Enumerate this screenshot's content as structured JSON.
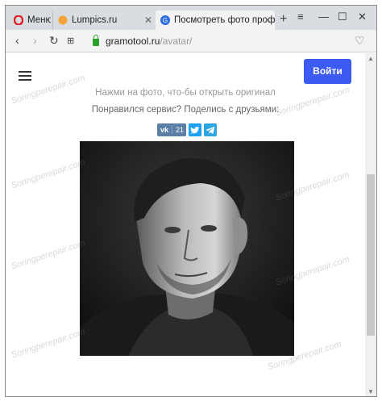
{
  "tabs": [
    {
      "label": "Меню"
    },
    {
      "label": "Lumpics.ru"
    },
    {
      "label": "Посмотреть фото проф"
    }
  ],
  "address": {
    "host": "gramotool.ru",
    "path": "/avatar/"
  },
  "header": {
    "login_label": "Войти"
  },
  "content": {
    "hint": "Нажми на фото, что-бы открыть оригинал",
    "share_prompt": "Понравился сервис? Поделись с друзьями:",
    "vk_label": "vk",
    "vk_count": "21"
  },
  "watermark": "Soringperepair.com",
  "colors": {
    "accent": "#3b5bf2",
    "vk": "#5b7fa6",
    "twitter": "#1da1f2",
    "telegram": "#2ca5e0"
  }
}
